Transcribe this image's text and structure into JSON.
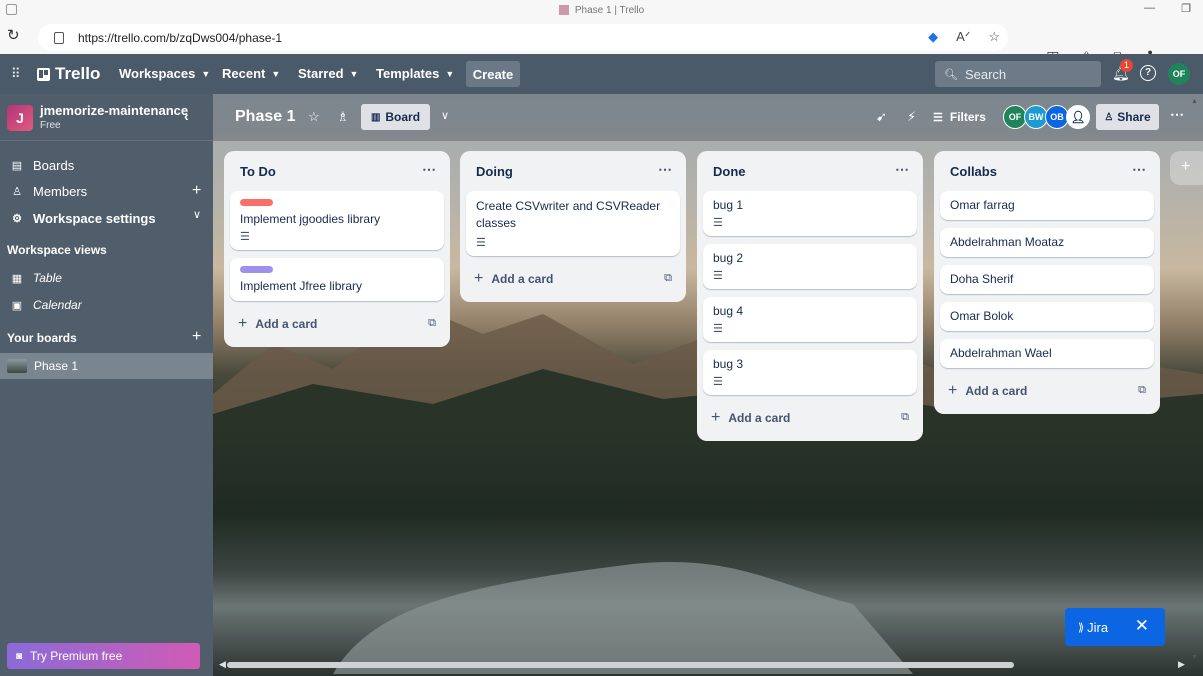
{
  "browser": {
    "tab_title": "Phase 1 | Trello",
    "url": "https://trello.com/b/zqDws004/phase-1"
  },
  "topnav": {
    "logo": "Trello",
    "workspaces": "Workspaces",
    "recent": "Recent",
    "starred": "Starred",
    "templates": "Templates",
    "create": "Create",
    "search_placeholder": "Search",
    "notification_count": "1",
    "user_initials": "OF"
  },
  "sidebar": {
    "workspace_initial": "J",
    "workspace_name": "jmemorize-maintenance",
    "workspace_plan": "Free",
    "boards": "Boards",
    "members": "Members",
    "workspace_settings": "Workspace settings",
    "workspace_views_title": "Workspace views",
    "view_table": "Table",
    "view_calendar": "Calendar",
    "your_boards_title": "Your boards",
    "board_phase1": "Phase 1",
    "premium": "Try Premium free"
  },
  "boardbar": {
    "title": "Phase 1",
    "view": "Board",
    "filters": "Filters",
    "members": [
      {
        "initials": "OF",
        "color": "#1f845a"
      },
      {
        "initials": "BW",
        "color": "#1d9bd1"
      },
      {
        "initials": "OB",
        "color": "#0c66e4"
      }
    ],
    "share": "Share"
  },
  "lists": [
    {
      "title": "To Do",
      "cards": [
        {
          "label_color": "#f87168",
          "title": "Implement jgoodies library",
          "has_desc": true
        },
        {
          "label_color": "#9f8fef",
          "title": "Implement Jfree library",
          "has_desc": false
        }
      ],
      "add": "Add a card"
    },
    {
      "title": "Doing",
      "cards": [
        {
          "label_color": "",
          "title": "Create CSVwriter and CSVReader classes",
          "has_desc": true
        }
      ],
      "add": "Add a card"
    },
    {
      "title": "Done",
      "cards": [
        {
          "label_color": "",
          "title": "bug 1",
          "has_desc": true
        },
        {
          "label_color": "",
          "title": "bug 2",
          "has_desc": true
        },
        {
          "label_color": "",
          "title": "bug 4",
          "has_desc": true
        },
        {
          "label_color": "",
          "title": "bug 3",
          "has_desc": true
        }
      ],
      "add": "Add a card"
    },
    {
      "title": "Collabs",
      "cards": [
        {
          "label_color": "",
          "title": "Omar farrag",
          "has_desc": false
        },
        {
          "label_color": "",
          "title": "Abdelrahman Moataz",
          "has_desc": false
        },
        {
          "label_color": "",
          "title": "Doha Sherif",
          "has_desc": false
        },
        {
          "label_color": "",
          "title": "Omar Bolok",
          "has_desc": false
        },
        {
          "label_color": "",
          "title": "Abdelrahman Wael",
          "has_desc": false
        }
      ],
      "add": "Add a card"
    }
  ],
  "jira": {
    "label": "Jira"
  }
}
